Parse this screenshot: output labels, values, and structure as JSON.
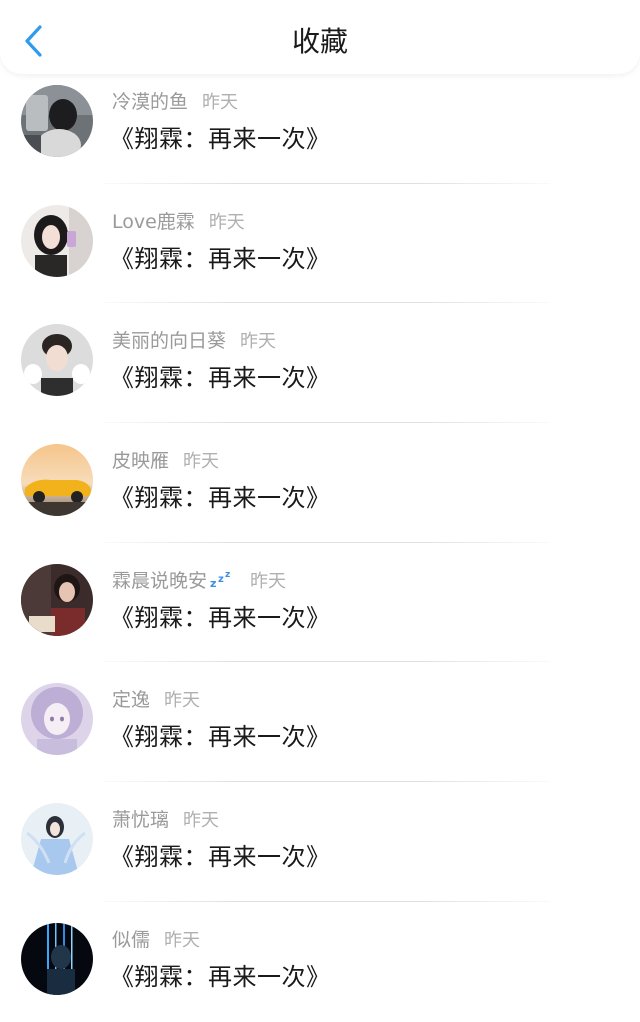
{
  "header": {
    "title": "收藏",
    "back_icon": "chevron-left-icon",
    "accent_color": "#2f9bef"
  },
  "items": [
    {
      "name": "冷漠的鱼",
      "time": "昨天",
      "title": "《翔霖：再来一次》"
    },
    {
      "name": "Love鹿霖",
      "time": "昨天",
      "title": "《翔霖：再来一次》"
    },
    {
      "name": "美丽的向日葵",
      "time": "昨天",
      "title": "《翔霖：再来一次》"
    },
    {
      "name": "皮映雁",
      "time": "昨天",
      "title": "《翔霖：再来一次》"
    },
    {
      "name": "霖晨说晚安",
      "time": "昨天",
      "title": "《翔霖：再来一次》",
      "emoji": "zzz-icon"
    },
    {
      "name": "定逸",
      "time": "昨天",
      "title": "《翔霖：再来一次》"
    },
    {
      "name": "萧忧璃",
      "time": "昨天",
      "title": "《翔霖：再来一次》"
    },
    {
      "name": "似儒",
      "time": "昨天",
      "title": "《翔霖：再来一次》"
    }
  ]
}
